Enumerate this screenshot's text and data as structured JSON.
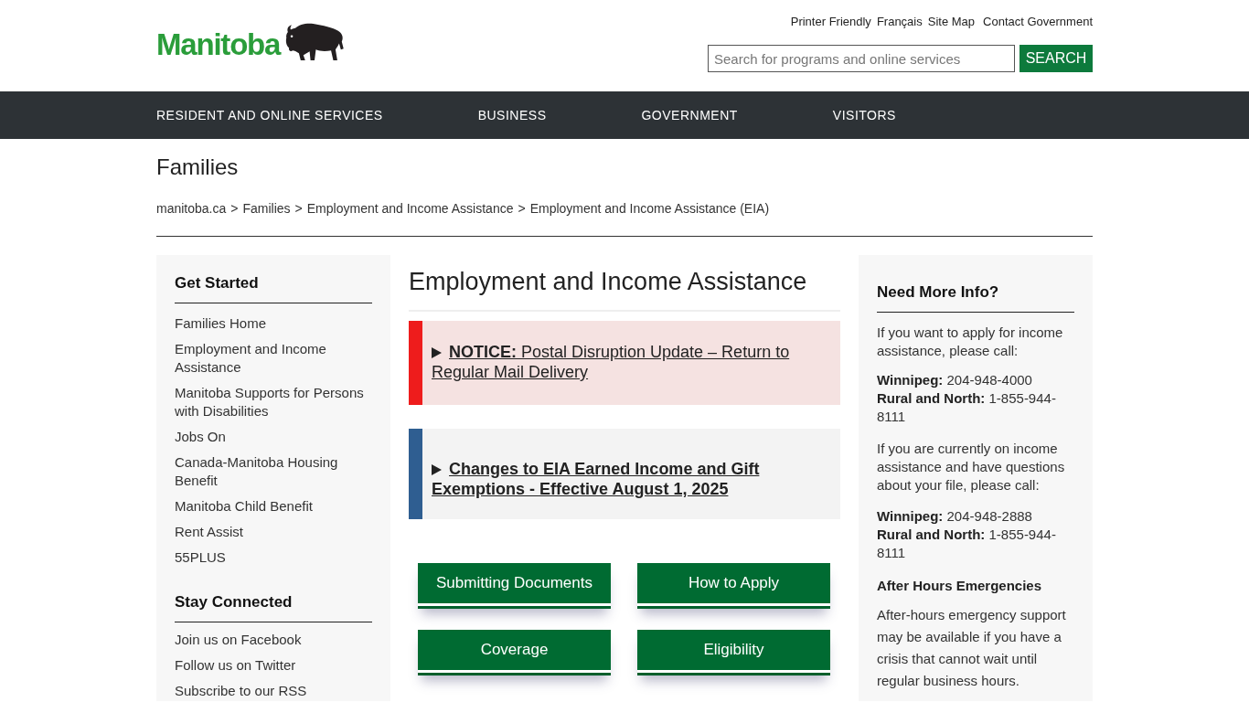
{
  "header": {
    "logo": "Manitoba",
    "utility_links": [
      "Printer Friendly",
      "Français",
      "Site Map",
      "Contact Government"
    ],
    "search": {
      "placeholder": "Search for programs and online services",
      "button": "SEARCH"
    }
  },
  "nav": {
    "items": [
      "RESIDENT AND ONLINE SERVICES",
      "BUSINESS",
      "GOVERNMENT",
      "VISITORS"
    ]
  },
  "section_title": "Families",
  "breadcrumb": {
    "separator": ">",
    "items": [
      "manitoba.ca",
      "Families",
      "Employment and Income Assistance",
      "Employment and Income Assistance (EIA)"
    ]
  },
  "sidebar": {
    "sections": [
      {
        "heading": "Get Started",
        "links": [
          "Families Home",
          "Employment and Income Assistance",
          "Manitoba Supports for Persons with Disabilities",
          "Jobs On",
          "Canada-Manitoba Housing Benefit",
          "Manitoba Child Benefit",
          "Rent Assist",
          "55PLUS"
        ]
      },
      {
        "heading": "Stay Connected",
        "links": [
          "Join us on Facebook",
          "Follow us on Twitter",
          "Subscribe to our RSS"
        ]
      }
    ]
  },
  "main": {
    "title": "Employment and Income Assistance",
    "notices": [
      {
        "kind": "alert",
        "expanded": false,
        "text": "**NOTICE:** Postal Disruption Update – Return to Regular Mail Delivery"
      },
      {
        "kind": "update",
        "expanded": false,
        "text": "Changes to EIA Earned Income and Gift Exemptions - Effective August 1, 2025"
      }
    ],
    "buttons": [
      "Submitting Documents",
      "How to Apply",
      "Coverage",
      "Eligibility"
    ]
  },
  "info_panel": {
    "heading": "Need More Info?",
    "blocks": [
      {
        "kind": "paragraph",
        "text": "If you want to apply for income assistance, please call:"
      },
      {
        "kind": "contacts",
        "lines": [
          "**Winnipeg:** 204-948-4000",
          "**Rural and North:** 1-855-944-8111"
        ]
      },
      {
        "kind": "paragraph",
        "text": "If you are currently on income assistance and have questions about your file, please call:"
      },
      {
        "kind": "contacts",
        "lines": [
          "**Winnipeg:** 204-948-2888",
          "**Rural and North:**  1-855-944-8111"
        ]
      },
      {
        "kind": "subheading",
        "text": "After Hours Emergencies"
      },
      {
        "kind": "note",
        "text": "After-hours emergency support may be available if you have a crisis that cannot wait until regular business hours."
      }
    ]
  }
}
